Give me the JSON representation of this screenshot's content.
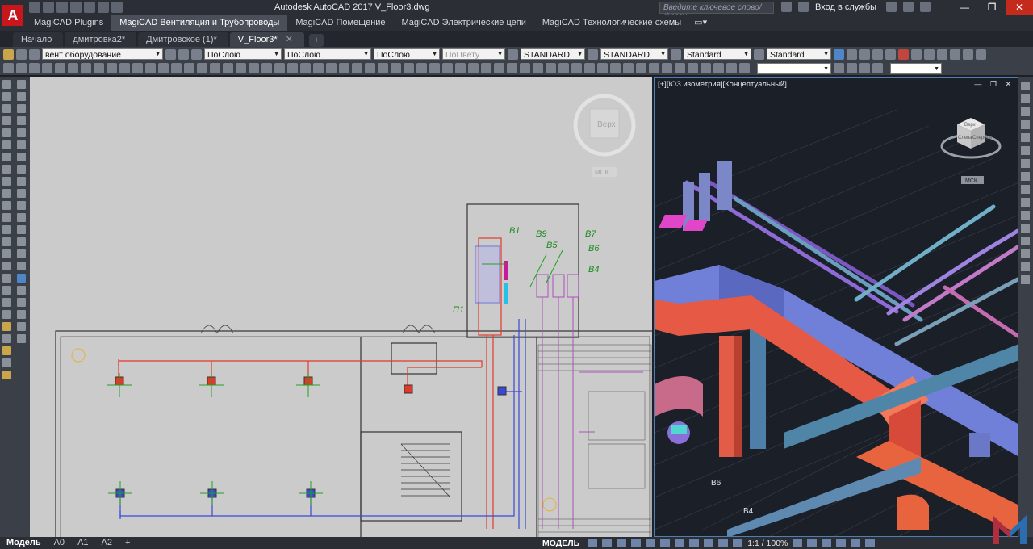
{
  "window": {
    "title": "Autodesk AutoCAD 2017    V_Floor3.dwg",
    "search_placeholder": "Введите ключевое слово/фразу",
    "signin_label": "Вход в службы"
  },
  "ribbon_tabs": [
    {
      "label": "MagiCAD Plugins"
    },
    {
      "label": "MagiCAD Вентиляция и Трубопроводы"
    },
    {
      "label": "MagiCAD Помещение"
    },
    {
      "label": "MagiCAD Электрические цепи"
    },
    {
      "label": "MagiCAD Технологические схемы"
    }
  ],
  "doc_tabs": [
    {
      "label": "Начало"
    },
    {
      "label": "дмитровка2*"
    },
    {
      "label": "Дмитровское (1)*"
    },
    {
      "label": "V_Floor3*"
    }
  ],
  "toolbar": {
    "layer": "вент оборудование",
    "color": "ПоСлою",
    "linetype": "ПоСлою",
    "lineweight": "ПоСлою",
    "plotstyle": "ПоЦвету",
    "text_style": "STANDARD",
    "dim_style": "STANDARD",
    "table_style": "Standard",
    "mleader_style": "Standard"
  },
  "plan": {
    "viewcube_face": "Верх",
    "ucs_label": "МСК",
    "labels": {
      "p1": "П1",
      "v1": "В1",
      "v4": "В4",
      "v5": "В5",
      "v6": "В6",
      "v7": "В7",
      "v9": "В9"
    }
  },
  "iso": {
    "viewport_label": "[+][ЮЗ изометрия][Концептуальный]",
    "ucs_label": "МСК",
    "labels": {
      "v4": "В4",
      "v6": "В6"
    },
    "cube_faces": {
      "top": "Верх",
      "left": "Слева",
      "front": "Спереди"
    }
  },
  "layouts": [
    {
      "label": "Модель"
    },
    {
      "label": "A0"
    },
    {
      "label": "A1"
    },
    {
      "label": "A2"
    }
  ],
  "status": {
    "mode": "МОДЕЛЬ",
    "scale": "1:1 / 100%"
  },
  "colors": {
    "supply_duct": "#e45a45",
    "exhaust_duct": "#7a7fe0",
    "pipe": "#6fb0c8",
    "magenta": "#e246c8",
    "green_text": "#1a9a1a"
  }
}
